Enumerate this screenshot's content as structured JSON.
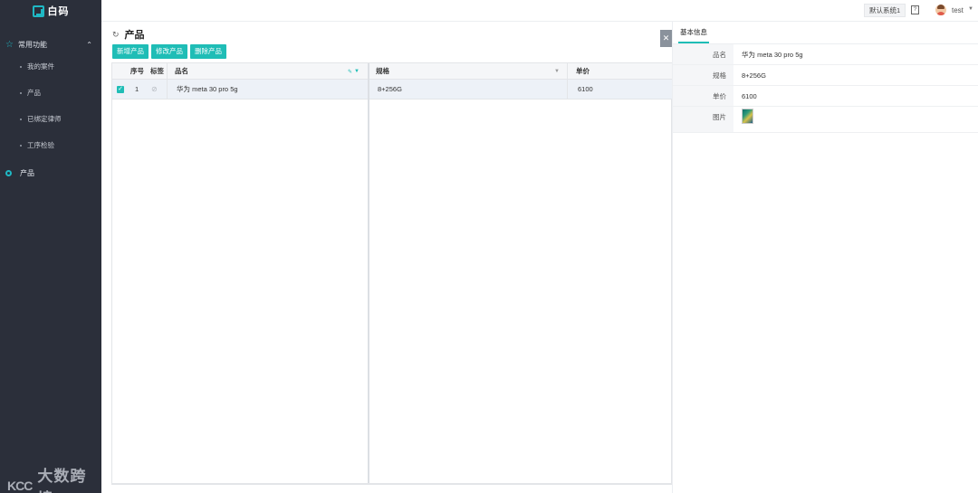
{
  "app": {
    "logo_text": "白码"
  },
  "sidebar": {
    "group": {
      "label": "常用功能",
      "items": [
        {
          "label": "我的案件"
        },
        {
          "label": "产品"
        },
        {
          "label": "已绑定律师"
        },
        {
          "label": "工序检验"
        }
      ]
    },
    "item": {
      "label": "产品"
    }
  },
  "watermark": {
    "logo": "KCC",
    "text": "大数跨境"
  },
  "topbar": {
    "system_label": "默认系统1",
    "help_glyph": "?",
    "user_name": "test"
  },
  "page": {
    "title": "产品"
  },
  "toolbar": {
    "add_label": "新增产品",
    "edit_label": "修改产品",
    "delete_label": "删除产品"
  },
  "grid": {
    "columns": {
      "index": "序号",
      "tag": "标签",
      "name": "品名",
      "spec": "规格",
      "price": "单价"
    },
    "rows": [
      {
        "index": "1",
        "name": "华为 meta 30 pro 5g",
        "spec": "8+256G",
        "price": "6100",
        "selected": true
      }
    ]
  },
  "panel": {
    "tab_label": "基本信息",
    "fields": [
      {
        "label": "品名",
        "value": "华为 meta 30 pro 5g"
      },
      {
        "label": "规格",
        "value": "8+256G"
      },
      {
        "label": "单价",
        "value": "6100"
      },
      {
        "label": "图片",
        "value": ""
      }
    ]
  },
  "colors": {
    "accent": "#1fbdb6",
    "sidebar_bg": "#2b2f3a"
  }
}
